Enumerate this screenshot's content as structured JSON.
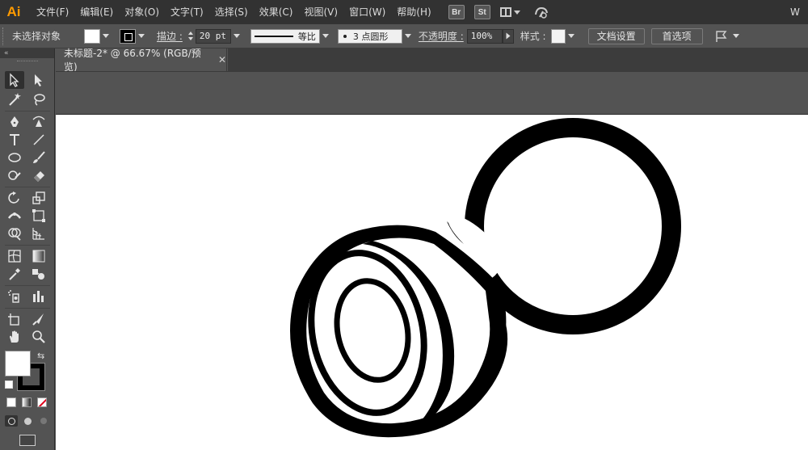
{
  "app": {
    "logo": "Ai"
  },
  "menu": {
    "items": [
      "文件(F)",
      "编辑(E)",
      "对象(O)",
      "文字(T)",
      "选择(S)",
      "效果(C)",
      "视图(V)",
      "窗口(W)",
      "帮助(H)"
    ],
    "bridge_label": "Br",
    "stock_label": "St",
    "right_label": "W"
  },
  "control_bar": {
    "selection_status": "未选择对象",
    "stroke_label": "描边 :",
    "stroke_weight": "20 pt",
    "profile_label": "等比",
    "brush_label": "3 点圆形",
    "opacity_label": "不透明度 :",
    "opacity_value": "100%",
    "style_label": "样式 :",
    "doc_setup_button": "文档设置",
    "preferences_button": "首选项",
    "fill_color": "#ffffff",
    "stroke_color": "#000000"
  },
  "tools_panel": {
    "collapse_label": "«",
    "tools": [
      "selection-tool",
      "direct-selection-tool",
      "magic-wand-tool",
      "lasso-tool",
      "pen-tool",
      "curvature-tool",
      "type-tool",
      "line-segment-tool",
      "ellipse-tool",
      "paintbrush-tool",
      "shaper-tool",
      "eraser-tool",
      "rotate-tool",
      "scale-tool",
      "width-tool",
      "free-transform-tool",
      "shape-builder-tool",
      "perspective-grid-tool",
      "mesh-tool",
      "gradient-tool",
      "eyedropper-tool",
      "blend-tool",
      "symbol-sprayer-tool",
      "column-graph-tool",
      "artboard-tool",
      "slice-tool",
      "hand-tool",
      "zoom-tool"
    ],
    "fill_swatch": "#ffffff",
    "stroke_swatch": "#000000"
  },
  "document": {
    "tab_title": "未标题-2* @ 66.67% (RGB/预览)",
    "close_glyph": "✕"
  }
}
